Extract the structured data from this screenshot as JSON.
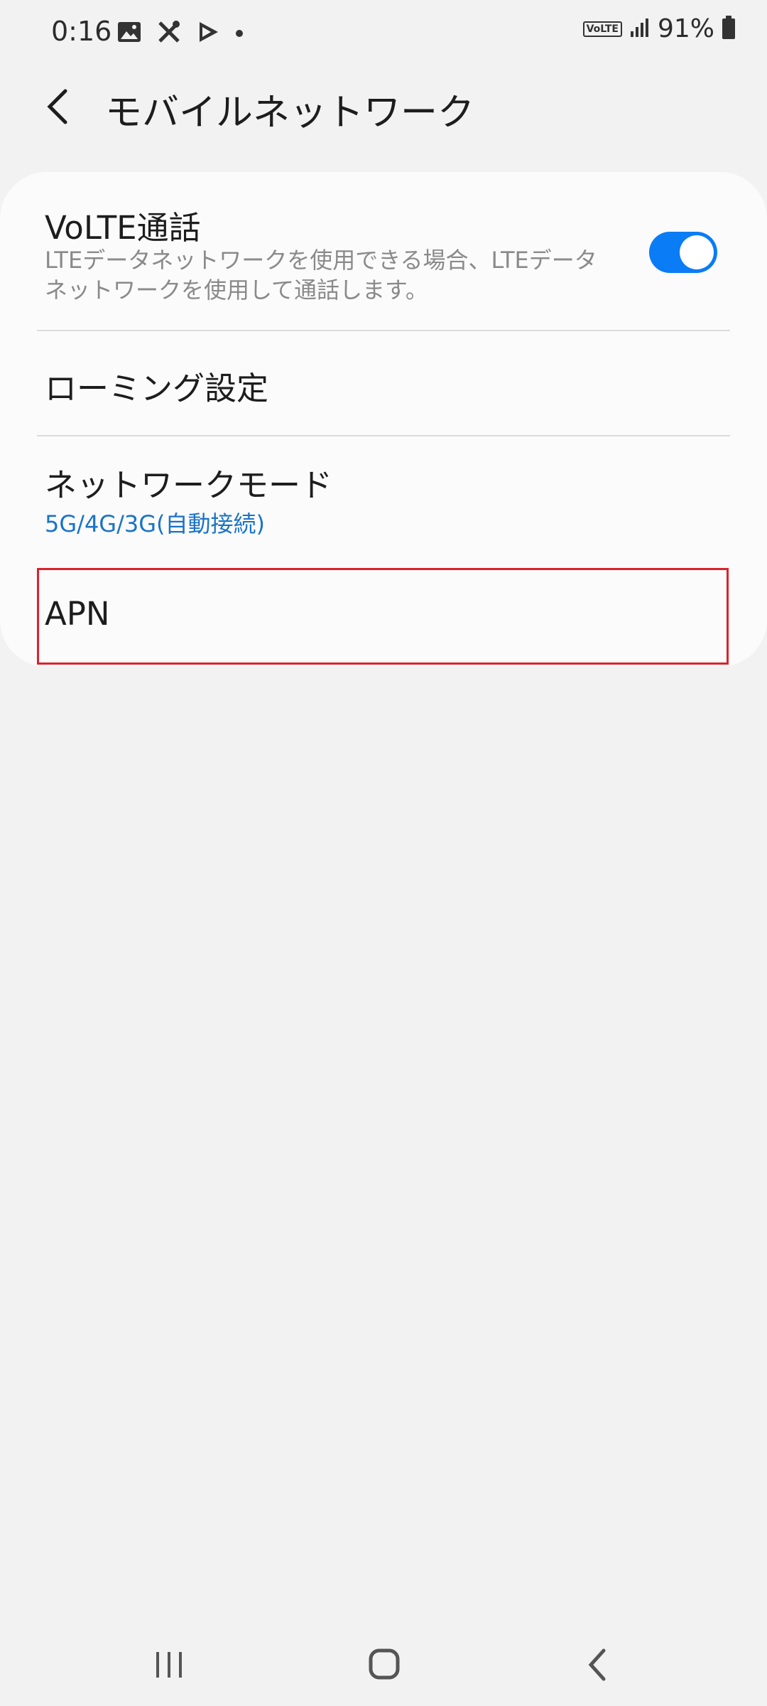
{
  "status_bar": {
    "time": "0:16",
    "notification_icons": [
      "image-icon",
      "tools-icon",
      "play-store-icon",
      "dot-icon"
    ],
    "volte_badge": "VoLTE",
    "battery": "91%"
  },
  "header": {
    "title": "モバイルネットワーク",
    "back_icon": "chevron-left-icon"
  },
  "settings": {
    "volte": {
      "title": "VoLTE通話",
      "description_line1": "LTEデータネットワークを使用できる場合、LTEデータ",
      "description_line2": "ネットワークを使用して通話します。",
      "enabled": true
    },
    "roaming": {
      "title": "ローミング設定"
    },
    "network_mode": {
      "title": "ネットワークモード",
      "value": "5G/4G/3G(自動接続)"
    },
    "apn": {
      "title": "APN"
    }
  },
  "colors": {
    "accent": "#0a7cf5",
    "highlight": "#d9232d",
    "subtext_blue": "#1a73c8"
  },
  "nav_bar": {
    "icons": [
      "recents-icon",
      "home-icon",
      "back-icon"
    ]
  }
}
